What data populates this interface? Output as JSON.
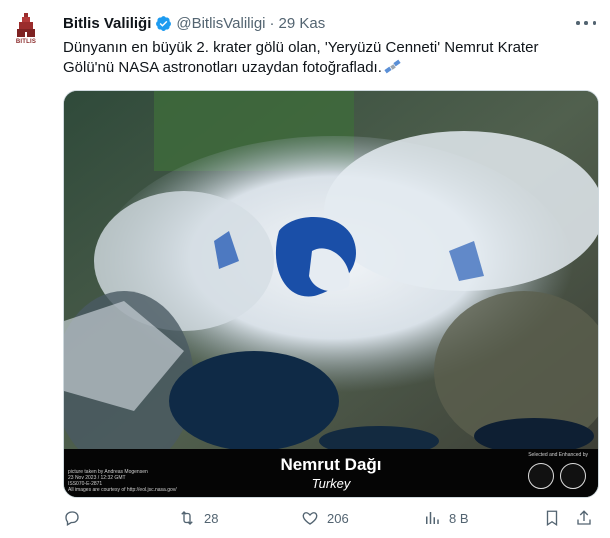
{
  "tweet": {
    "author_name": "Bitlis Valiliği",
    "handle": "@BitlisValiligi",
    "separator": "·",
    "timestamp": "29 Kas",
    "text": "Dünyanın en büyük 2. krater gölü olan, 'Yeryüzü Cenneti' Nemrut Krater Gölü'nü NASA astronotları uzaydan fotoğrafladı.",
    "avatar_label": "BITLIS"
  },
  "media": {
    "caption_title": "Nemrut Dağı",
    "caption_subtitle": "Turkey",
    "credit_lines": [
      "picture taken by Andreas Mogensen",
      "23 Nov 2023 / 12:32 GMT",
      "ISS070-E-2871",
      "All images are courtesy of http://eol.jsc.nasa.gov/"
    ],
    "selected_label": "Selected and Enhanced by"
  },
  "actions": {
    "reply": "",
    "retweets": "28",
    "likes": "206",
    "views": "8 B"
  },
  "colors": {
    "text": "#0f1419",
    "muted": "#536471",
    "verified": "#1d9bf0"
  },
  "icons": [
    "verified-badge-icon",
    "more-icon",
    "satellite-emoji-icon",
    "reply-icon",
    "retweet-icon",
    "like-icon",
    "views-icon",
    "bookmark-icon",
    "share-icon"
  ]
}
